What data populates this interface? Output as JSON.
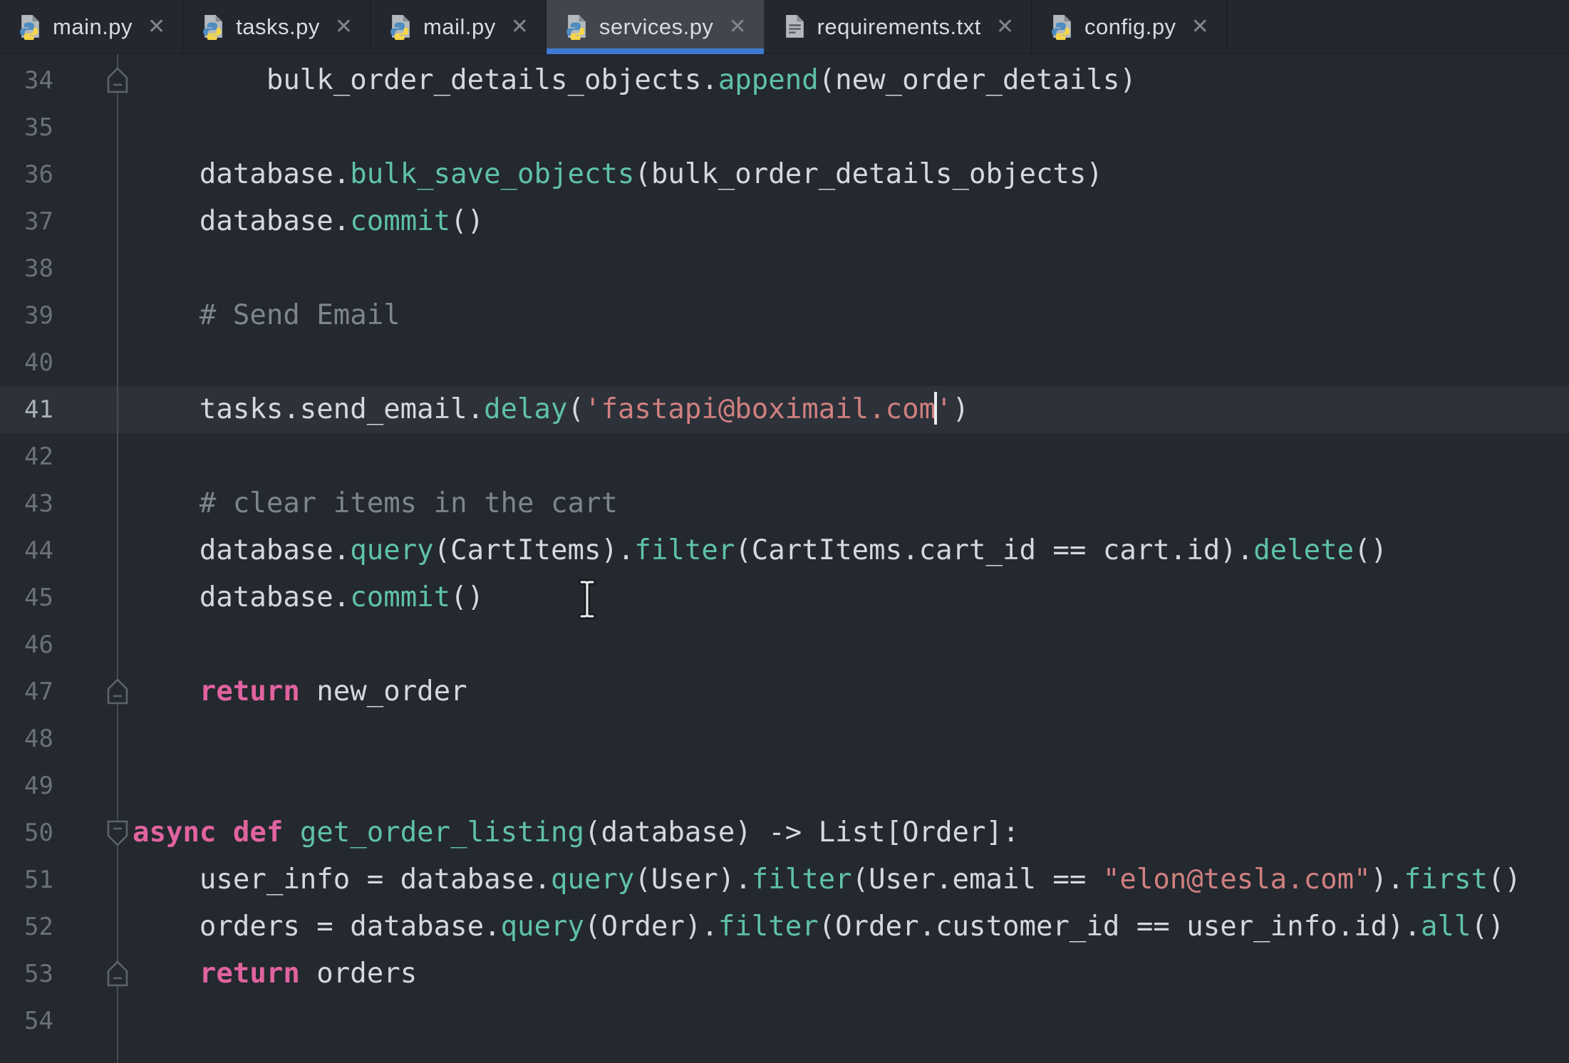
{
  "window_title": "services.py",
  "tabs": [
    {
      "label": "main.py",
      "icon": "python",
      "close_glyph": "✕",
      "active": false
    },
    {
      "label": "tasks.py",
      "icon": "python",
      "close_glyph": "✕",
      "active": false
    },
    {
      "label": "mail.py",
      "icon": "python",
      "close_glyph": "✕",
      "active": false
    },
    {
      "label": "services.py",
      "icon": "python",
      "close_glyph": "✕",
      "active": true
    },
    {
      "label": "requirements.txt",
      "icon": "text",
      "close_glyph": "✕",
      "active": false
    },
    {
      "label": "config.py",
      "icon": "python",
      "close_glyph": "✕",
      "active": false
    }
  ],
  "editor": {
    "first_visible_line": 34,
    "last_visible_line": 54,
    "current_line": 41,
    "caret_after_text": "'fastapi@boximail.com",
    "lines": [
      {
        "n": 34,
        "fold": "up",
        "segs": [
          [
            "        bulk_order_details_objects.",
            "plain"
          ],
          [
            "append",
            "func"
          ],
          [
            "(new_order_details)",
            "plain"
          ]
        ]
      },
      {
        "n": 35,
        "segs": []
      },
      {
        "n": 36,
        "segs": [
          [
            "    database.",
            "plain"
          ],
          [
            "bulk_save_objects",
            "func"
          ],
          [
            "(bulk_order_details_objects)",
            "plain"
          ]
        ]
      },
      {
        "n": 37,
        "segs": [
          [
            "    database.",
            "plain"
          ],
          [
            "commit",
            "func"
          ],
          [
            "()",
            "plain"
          ]
        ]
      },
      {
        "n": 38,
        "segs": []
      },
      {
        "n": 39,
        "segs": [
          [
            "    # Send Email",
            "comment"
          ]
        ]
      },
      {
        "n": 40,
        "segs": []
      },
      {
        "n": 41,
        "current": true,
        "segs": [
          [
            "    tasks.send_email.",
            "plain"
          ],
          [
            "delay",
            "func"
          ],
          [
            "(",
            "plain"
          ],
          [
            "'fastapi@boximail.com",
            "string"
          ],
          [
            "",
            "caret"
          ],
          [
            "'",
            "string"
          ],
          [
            ")",
            "plain"
          ]
        ]
      },
      {
        "n": 42,
        "segs": []
      },
      {
        "n": 43,
        "segs": [
          [
            "    # clear items in the cart",
            "comment"
          ]
        ]
      },
      {
        "n": 44,
        "segs": [
          [
            "    database.",
            "plain"
          ],
          [
            "query",
            "func"
          ],
          [
            "(CartItems).",
            "plain"
          ],
          [
            "filter",
            "func"
          ],
          [
            "(CartItems.cart_id == cart.id).",
            "plain"
          ],
          [
            "delete",
            "func"
          ],
          [
            "()",
            "plain"
          ]
        ]
      },
      {
        "n": 45,
        "segs": [
          [
            "    database.",
            "plain"
          ],
          [
            "commit",
            "func"
          ],
          [
            "()",
            "plain"
          ]
        ]
      },
      {
        "n": 46,
        "segs": []
      },
      {
        "n": 47,
        "fold": "up",
        "segs": [
          [
            "    ",
            "plain"
          ],
          [
            "return",
            "keyword"
          ],
          [
            " new_order",
            "plain"
          ]
        ]
      },
      {
        "n": 48,
        "segs": []
      },
      {
        "n": 49,
        "segs": []
      },
      {
        "n": 50,
        "fold": "down",
        "segs": [
          [
            "async def",
            "keyword"
          ],
          [
            " ",
            "plain"
          ],
          [
            "get_order_listing",
            "func"
          ],
          [
            "(database) -> List[Order]:",
            "plain"
          ]
        ]
      },
      {
        "n": 51,
        "segs": [
          [
            "    user_info = database.",
            "plain"
          ],
          [
            "query",
            "func"
          ],
          [
            "(User).",
            "plain"
          ],
          [
            "filter",
            "func"
          ],
          [
            "(User.email == ",
            "plain"
          ],
          [
            "\"elon@tesla.com\"",
            "string"
          ],
          [
            ").",
            "plain"
          ],
          [
            "first",
            "func"
          ],
          [
            "()",
            "plain"
          ]
        ]
      },
      {
        "n": 52,
        "segs": [
          [
            "    orders = database.",
            "plain"
          ],
          [
            "query",
            "func"
          ],
          [
            "(Order).",
            "plain"
          ],
          [
            "filter",
            "func"
          ],
          [
            "(Order.customer_id == user_info.id).",
            "plain"
          ],
          [
            "all",
            "func"
          ],
          [
            "()",
            "plain"
          ]
        ]
      },
      {
        "n": 53,
        "fold": "up",
        "segs": [
          [
            "    ",
            "plain"
          ],
          [
            "return",
            "keyword"
          ],
          [
            " orders",
            "plain"
          ]
        ]
      },
      {
        "n": 54,
        "segs": []
      }
    ]
  },
  "colors": {
    "editor_background": "#24282f",
    "current_line_background": "#2d3139",
    "active_tab_background": "#42464c",
    "active_tab_underline": "#3e7ad2",
    "plain_text": "#d5d8dd",
    "method_name": "#5fc2a6",
    "keyword": "#e0639f",
    "string": "#d08080",
    "comment": "#7e858f",
    "line_number": "#6b717a",
    "active_line_number": "#abb1b9",
    "gutter_line": "#454b54"
  }
}
